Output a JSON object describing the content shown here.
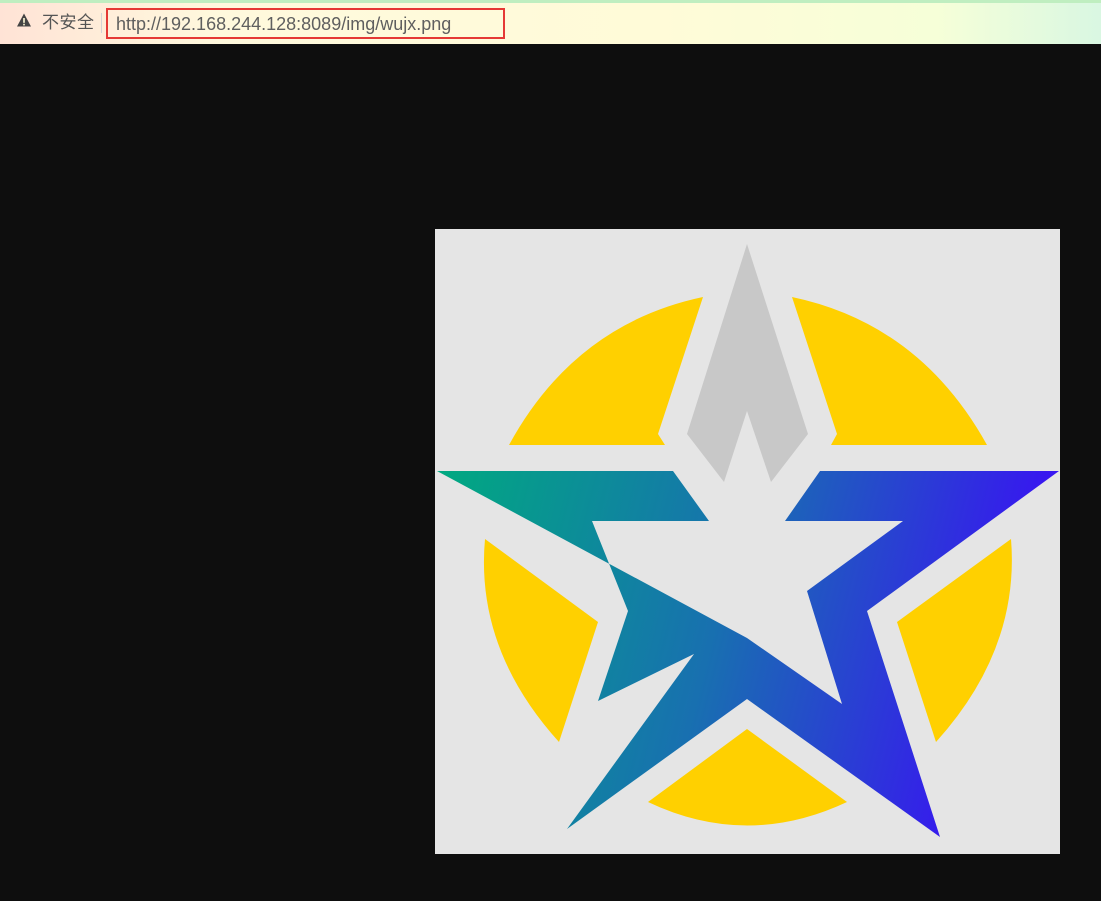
{
  "address_bar": {
    "security_label": "不安全",
    "url": "http://192.168.244.128:8089/img/wujx.png",
    "warning_icon": "warning-triangle-icon"
  },
  "image": {
    "file_name": "wujx.png",
    "background_color": "#e5e5e5",
    "circle_color": "#ffd000",
    "top_point_color": "#c8c8c8",
    "star_gradient_start": "#00aa80",
    "star_gradient_end": "#3a10f5"
  },
  "page": {
    "background_color": "#0e0e0e"
  }
}
